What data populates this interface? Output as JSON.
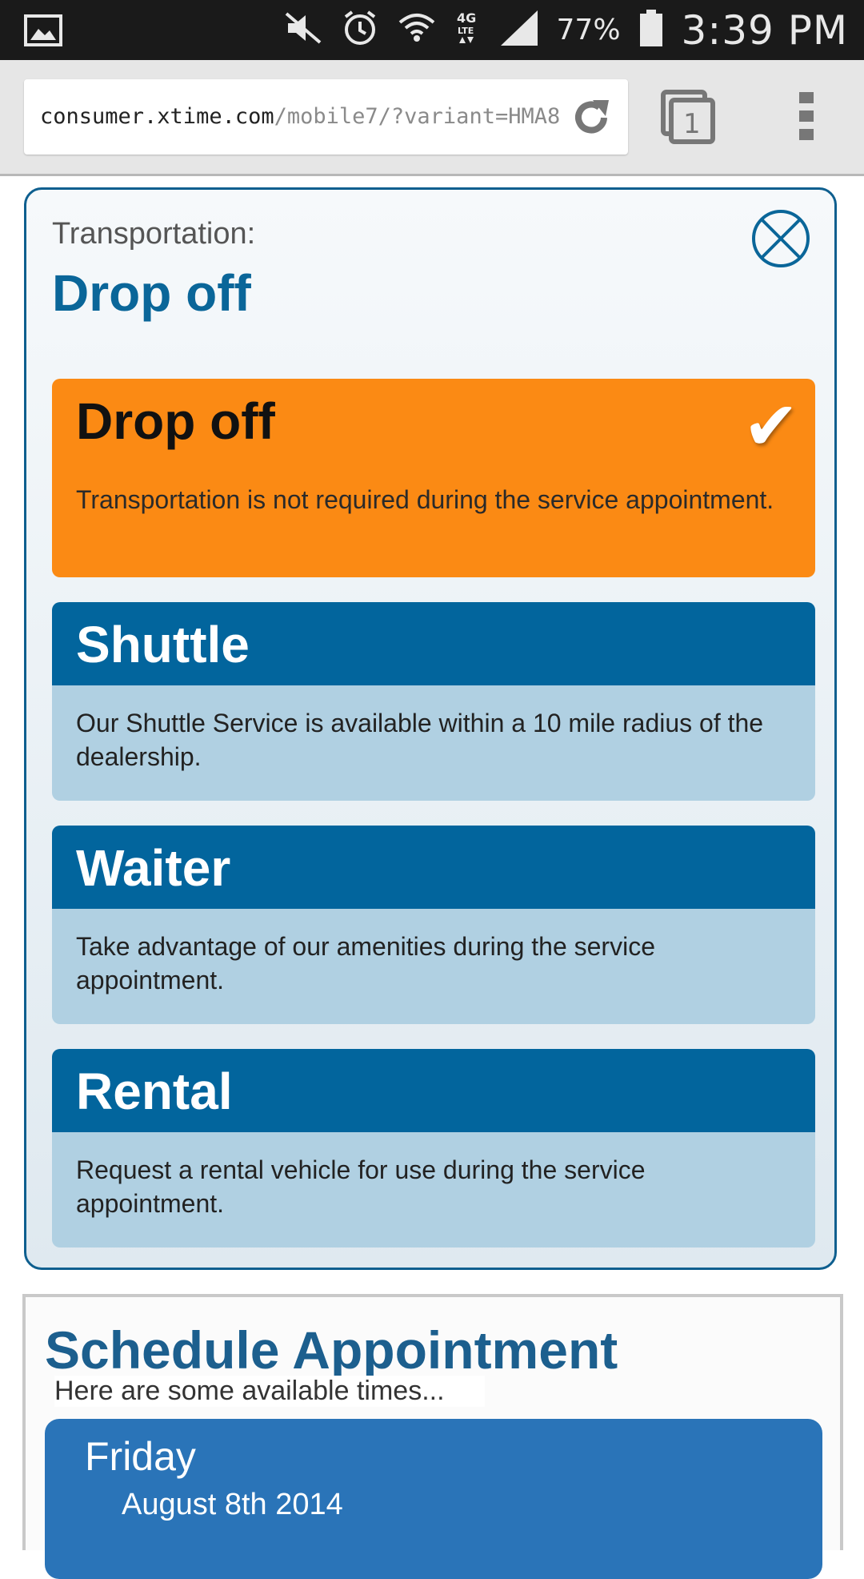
{
  "status_bar": {
    "battery": "77%",
    "time": "3:39 PM",
    "icons": [
      "image-icon",
      "mute-icon",
      "alarm-icon",
      "wifi-icon",
      "lte-icon",
      "signal-icon",
      "battery-icon"
    ]
  },
  "browser": {
    "url_host": "consumer.xtime.com",
    "url_path": "/mobile7/?variant=HMA8",
    "tab_count": "1"
  },
  "modal": {
    "label": "Transportation:",
    "selected_title": "Drop off",
    "options": [
      {
        "name": "Drop off",
        "description": "Transportation is not required during the service appointment.",
        "selected": true
      },
      {
        "name": "Shuttle",
        "description": "Our Shuttle Service is available within a 10 mile radius of the dealership.",
        "selected": false
      },
      {
        "name": "Waiter",
        "description": "Take advantage of our amenities during the service appointment.",
        "selected": false
      },
      {
        "name": "Rental",
        "description": "Request a rental vehicle for use during the service appointment.",
        "selected": false
      }
    ]
  },
  "schedule": {
    "title": "Schedule Appointment",
    "subtitle": "Here are some available times...",
    "day": "Friday",
    "date": "August 8th 2014"
  },
  "colors": {
    "accent_blue": "#02659d",
    "selected_orange": "#fb8a14",
    "option_body": "#b0d0e2"
  }
}
